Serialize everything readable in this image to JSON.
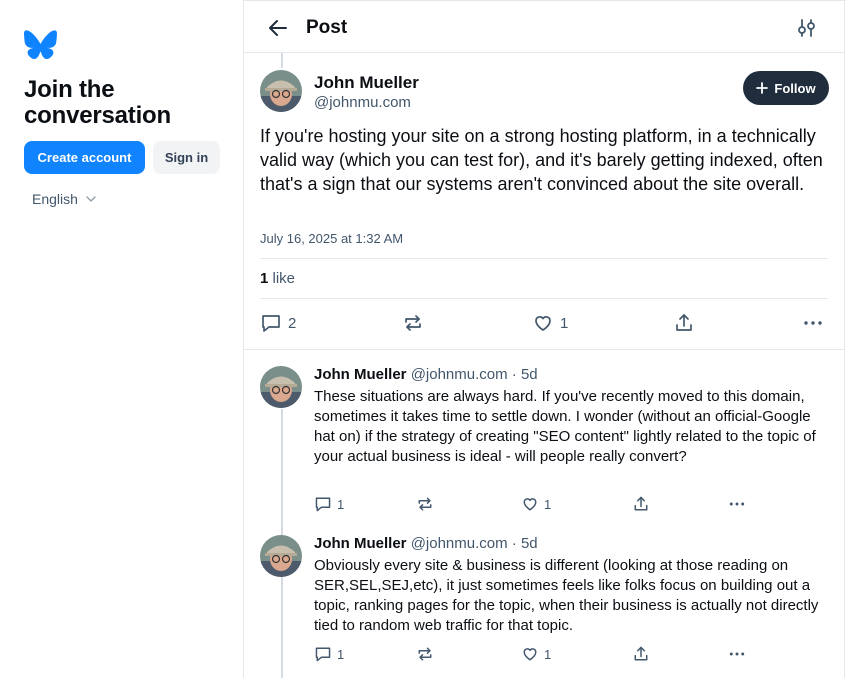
{
  "sidebar": {
    "join_title": "Join the conversation",
    "create_account": "Create account",
    "sign_in": "Sign in",
    "language": "English"
  },
  "header": {
    "title": "Post"
  },
  "post": {
    "author_name": "John Mueller",
    "author_handle": "@johnmu.com",
    "follow_label": "Follow",
    "text": "If you're hosting your site on a strong hosting platform, in a technically valid way (which you can test for), and it's barely getting indexed, often that's a sign that our systems aren't convinced about the site overall.",
    "timestamp": "July 16, 2025 at 1:32 AM",
    "like_count": "1",
    "like_word": "like",
    "reply_count": "2",
    "heart_count": "1"
  },
  "replies": [
    {
      "author_name": "John Mueller",
      "meta": "@johnmu.com · 5d",
      "text": "These situations are always hard. If you've recently moved to this domain, sometimes it takes time to settle down. I wonder (without an official-Google hat on) if the strategy of creating \"SEO content\" lightly related to the topic of your actual business is ideal - will people really convert?",
      "reply_count": "1",
      "like_count": "1"
    },
    {
      "author_name": "John Mueller",
      "meta": "@johnmu.com · 5d",
      "text": "Obviously every site & business is different (looking at those reading on SER,SEL,SEJ,etc), it just sometimes feels like folks focus on building out a topic, ranking pages for the topic, when their business is actually not directly tied to random web traffic for that topic.",
      "reply_count": "1",
      "like_count": "1"
    }
  ],
  "colors": {
    "brand_blue": "#1083fe",
    "follow_bg": "#1f2d3d",
    "muted_text": "#42576c",
    "divider": "#e4e8ec"
  },
  "icons": [
    "butterfly-logo-icon",
    "back-arrow-icon",
    "filter-icon",
    "plus-icon",
    "comment-icon",
    "repost-icon",
    "heart-icon",
    "share-icon",
    "more-icon",
    "chevron-down-icon"
  ]
}
